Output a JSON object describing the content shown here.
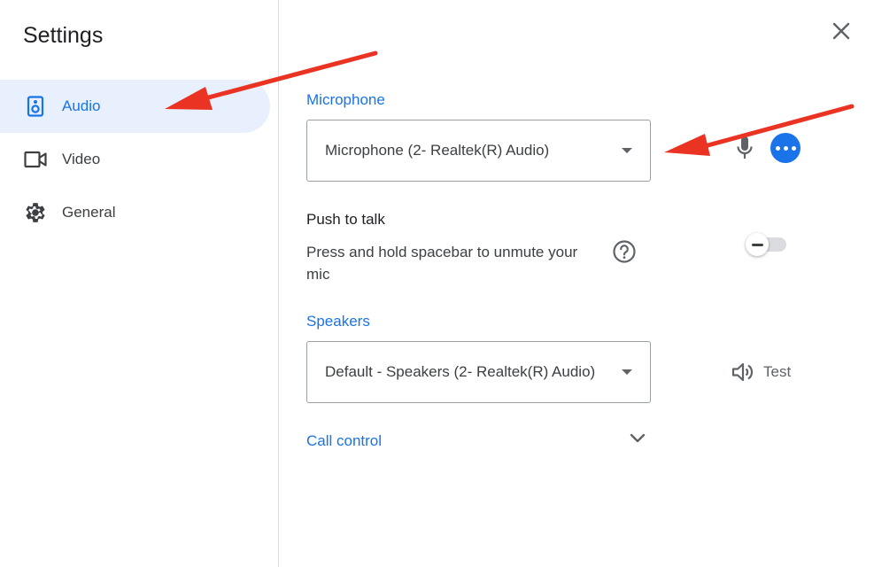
{
  "dialog": {
    "title": "Settings",
    "close_icon": "close-icon"
  },
  "sidebar": {
    "items": [
      {
        "label": "Audio",
        "icon": "speaker-icon",
        "active": true
      },
      {
        "label": "Video",
        "icon": "videocam-icon",
        "active": false
      },
      {
        "label": "General",
        "icon": "gear-icon",
        "active": false
      }
    ]
  },
  "audio": {
    "microphone": {
      "label": "Microphone",
      "selected": "Microphone (2- Realtek(R) Audio)",
      "mic_icon": "microphone-icon",
      "more_icon": "more-horiz-icon"
    },
    "push_to_talk": {
      "title": "Push to talk",
      "description": "Press and hold spacebar to unmute your mic",
      "help_icon": "help-circle-icon",
      "enabled": false
    },
    "speakers": {
      "label": "Speakers",
      "selected": "Default - Speakers (2- Realtek(R) Audio)",
      "test_label": "Test",
      "test_icon": "volume-icon"
    },
    "call_control": {
      "label": "Call control",
      "expand_icon": "chevron-down-icon"
    }
  },
  "colors": {
    "accent": "#1a73e8",
    "active_bg": "#e8f0fe",
    "annotation_arrow": "#ea3323"
  }
}
